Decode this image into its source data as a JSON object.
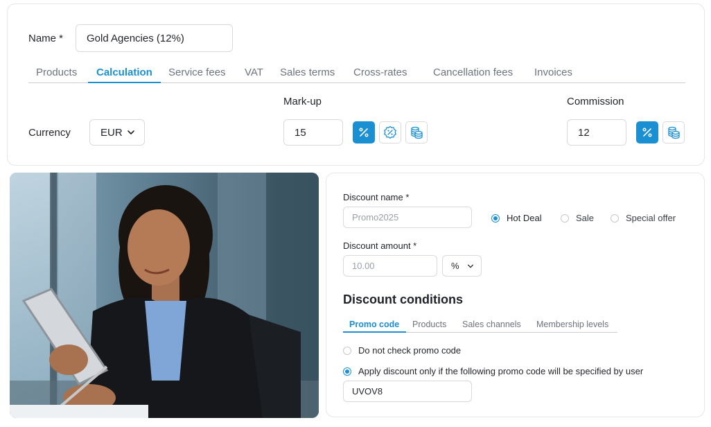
{
  "form": {
    "name_label": "Name *",
    "name_value": "Gold Agencies (12%)"
  },
  "tabs": [
    {
      "label": "Products"
    },
    {
      "label": "Calculation"
    },
    {
      "label": "Service fees"
    },
    {
      "label": "VAT"
    },
    {
      "label": "Sales terms"
    },
    {
      "label": "Cross-rates"
    },
    {
      "label": "Cancellation fees"
    },
    {
      "label": "Invoices"
    }
  ],
  "active_tab": "Calculation",
  "calculation": {
    "currency_label": "Currency",
    "currency_value": "EUR",
    "markup_label": "Mark-up",
    "markup_value": "15",
    "commission_label": "Commission",
    "commission_value": "12"
  },
  "discount": {
    "name_label": "Discount name *",
    "name_placeholder": "Promo2025",
    "types": [
      {
        "label": "Hot Deal",
        "selected": true
      },
      {
        "label": "Sale",
        "selected": false
      },
      {
        "label": "Special offer",
        "selected": false
      }
    ],
    "amount_label": "Discount amount *",
    "amount_placeholder": "10.00",
    "unit_value": "%",
    "conditions_title": "Discount conditions",
    "condition_tabs": [
      {
        "label": "Promo code"
      },
      {
        "label": "Products"
      },
      {
        "label": "Sales channels"
      },
      {
        "label": "Membership levels"
      }
    ],
    "active_condition_tab": "Promo code",
    "options": [
      {
        "label": "Do not check promo code",
        "selected": false
      },
      {
        "label": "Apply discount only if the following promo code will be specified by user",
        "selected": true
      }
    ],
    "promo_code_value": "UVOV8"
  },
  "icons": {
    "percent": "percent-icon",
    "discount_badge": "percent-badge-icon",
    "coins": "coins-icon",
    "chevron": "chevron-down-icon"
  },
  "colors": {
    "accent": "#1a8fd1",
    "border": "#d6dadf",
    "text": "#1f2329",
    "muted": "#6d737b"
  }
}
